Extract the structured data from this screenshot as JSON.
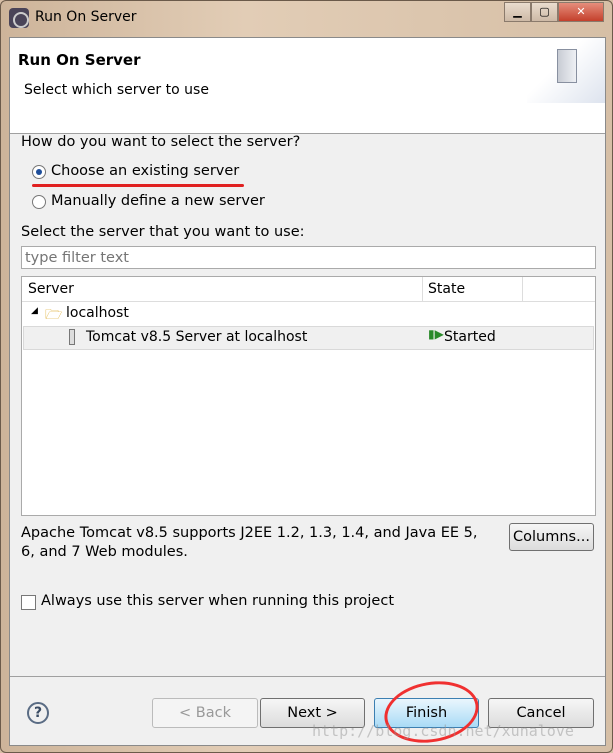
{
  "window": {
    "title": "Run On Server"
  },
  "header": {
    "title": "Run On Server",
    "subtitle": "Select which server to use",
    "icon": "server-icon"
  },
  "question": "How do you want to select the server?",
  "options": [
    {
      "label": "Choose an existing server",
      "selected": true
    },
    {
      "label": "Manually define a new server",
      "selected": false
    }
  ],
  "select_label": "Select the server that you want to use:",
  "filter": {
    "value": "",
    "placeholder": "type filter text"
  },
  "table": {
    "columns": [
      "Server",
      "State"
    ],
    "group": "localhost",
    "rows": [
      {
        "server": "Tomcat v8.5 Server at localhost",
        "state": "Started"
      }
    ]
  },
  "description": "Apache Tomcat v8.5 supports J2EE 1.2, 1.3, 1.4, and Java EE 5, 6, and 7 Web modules.",
  "columns_button": "Columns...",
  "always_use": {
    "label": "Always use this server when running this project",
    "checked": false
  },
  "buttons": {
    "help": "?",
    "back": "< Back",
    "next": "Next >",
    "finish": "Finish",
    "cancel": "Cancel"
  },
  "watermark": "http://blog.csdn.net/xunalove",
  "accent": "#e02020"
}
